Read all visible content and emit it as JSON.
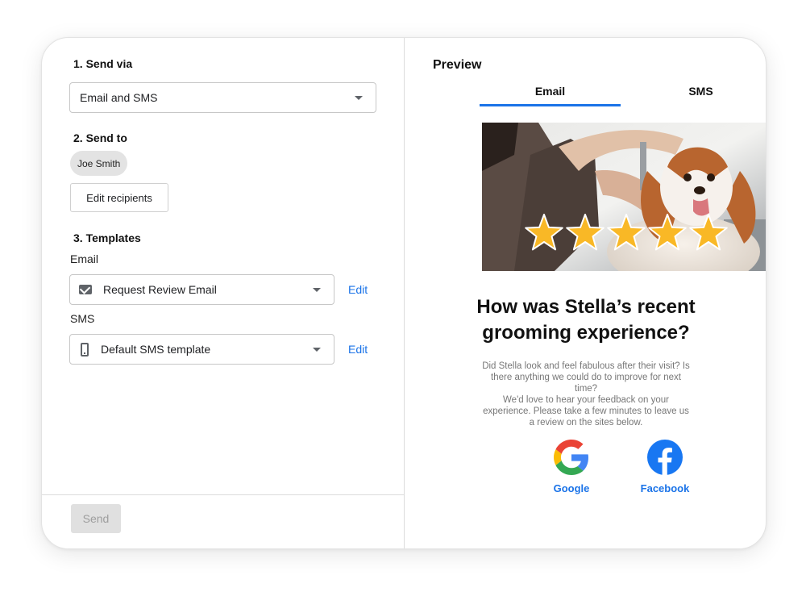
{
  "left": {
    "send_via": {
      "heading": "1. Send via",
      "value": "Email and SMS"
    },
    "send_to": {
      "heading": "2. Send to",
      "recipient": "Joe Smith",
      "edit_button": "Edit recipients"
    },
    "templates": {
      "heading": "3. Templates",
      "email_label": "Email",
      "email_value": "Request Review Email",
      "sms_label": "SMS",
      "sms_value": "Default SMS template",
      "edit_link": "Edit"
    },
    "send_button": "Send"
  },
  "preview": {
    "title": "Preview",
    "tabs": [
      {
        "label": "Email",
        "active": true
      },
      {
        "label": "SMS",
        "active": false
      }
    ],
    "headline": "How was Stella’s recent grooming experience?",
    "paragraph1": "Did Stella look and feel fabulous after their visit? Is there anything we could do to improve for next time?",
    "paragraph2": "We'd love to hear your feedback on your experience. Please take a few minutes to leave us a review on the sites below.",
    "rating_stars": 5,
    "google_label": "Google",
    "facebook_label": "Facebook"
  },
  "colors": {
    "accent": "#1a73e8",
    "star": "#f9b826",
    "facebook": "#1877f2"
  }
}
